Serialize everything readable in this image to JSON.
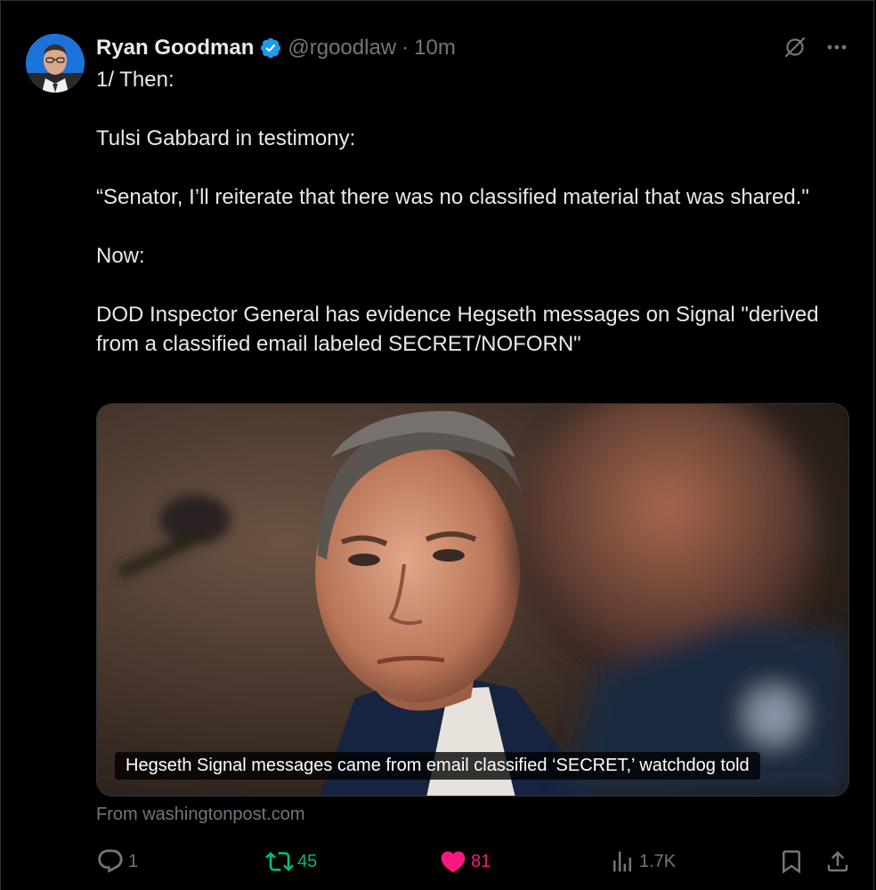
{
  "tweet": {
    "author": {
      "display_name": "Ryan Goodman",
      "handle": "@rgoodlaw",
      "separator": "·",
      "time": "10m",
      "verified": true
    },
    "text_lines": [
      "1/ Then:",
      "",
      "Tulsi Gabbard in testimony:",
      "",
      "“Senator, I’ll reiterate that there was no classified material that was shared.\"",
      "",
      "Now:",
      "",
      "DOD Inspector General has evidence Hegseth messages on Signal \"derived from a classified email labeled SECRET/NOFORN\""
    ],
    "card": {
      "headline": "Hegseth Signal messages came from email classified ‘SECRET,’ watchdog told",
      "source": "From washingtonpost.com"
    },
    "actions": {
      "replies": "1",
      "reposts": "45",
      "likes": "81",
      "views": "1.7K"
    }
  },
  "icons": {
    "grok": "grok-slash-circle-icon",
    "more": "more-dots-icon",
    "reply": "reply-bubble-icon",
    "repost": "repost-arrows-icon",
    "like": "heart-icon",
    "views": "bar-chart-icon",
    "bookmark": "bookmark-icon",
    "share": "share-upload-icon"
  },
  "colors": {
    "background": "#000000",
    "text": "#e7e9ea",
    "muted": "#71767b",
    "verified": "#1d9bf0",
    "repost_active": "#00ba7c",
    "like_active": "#f91880"
  }
}
